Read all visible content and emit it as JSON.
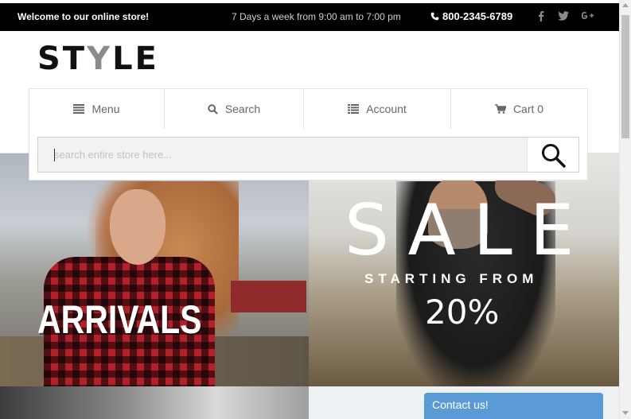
{
  "topbar": {
    "welcome": "Welcome to our online store!",
    "hours": "7 Days a week from 9:00 am to 7:00 pm",
    "phone": "800-2345-6789",
    "social": [
      "facebook-icon",
      "twitter-icon",
      "google-plus-icon"
    ]
  },
  "logo": {
    "part1": "ST",
    "part2": "Y",
    "part3": "LE"
  },
  "nav": {
    "items": [
      {
        "label": "Menu",
        "icon": "menu-icon"
      },
      {
        "label": "Search",
        "icon": "search-icon"
      },
      {
        "label": "Account",
        "icon": "account-icon"
      },
      {
        "label": "Cart 0",
        "icon": "cart-icon"
      }
    ]
  },
  "search": {
    "placeholder": "search entire store here...",
    "value": ""
  },
  "banners": {
    "left_title": "ARRIVALS",
    "right_title": "SALE",
    "right_subtitle": "STARTING FROM",
    "right_percent": "20%"
  },
  "contact": {
    "label": "Contact us!"
  },
  "colors": {
    "accent": "#5b9bd5",
    "topbar": "#000000"
  }
}
